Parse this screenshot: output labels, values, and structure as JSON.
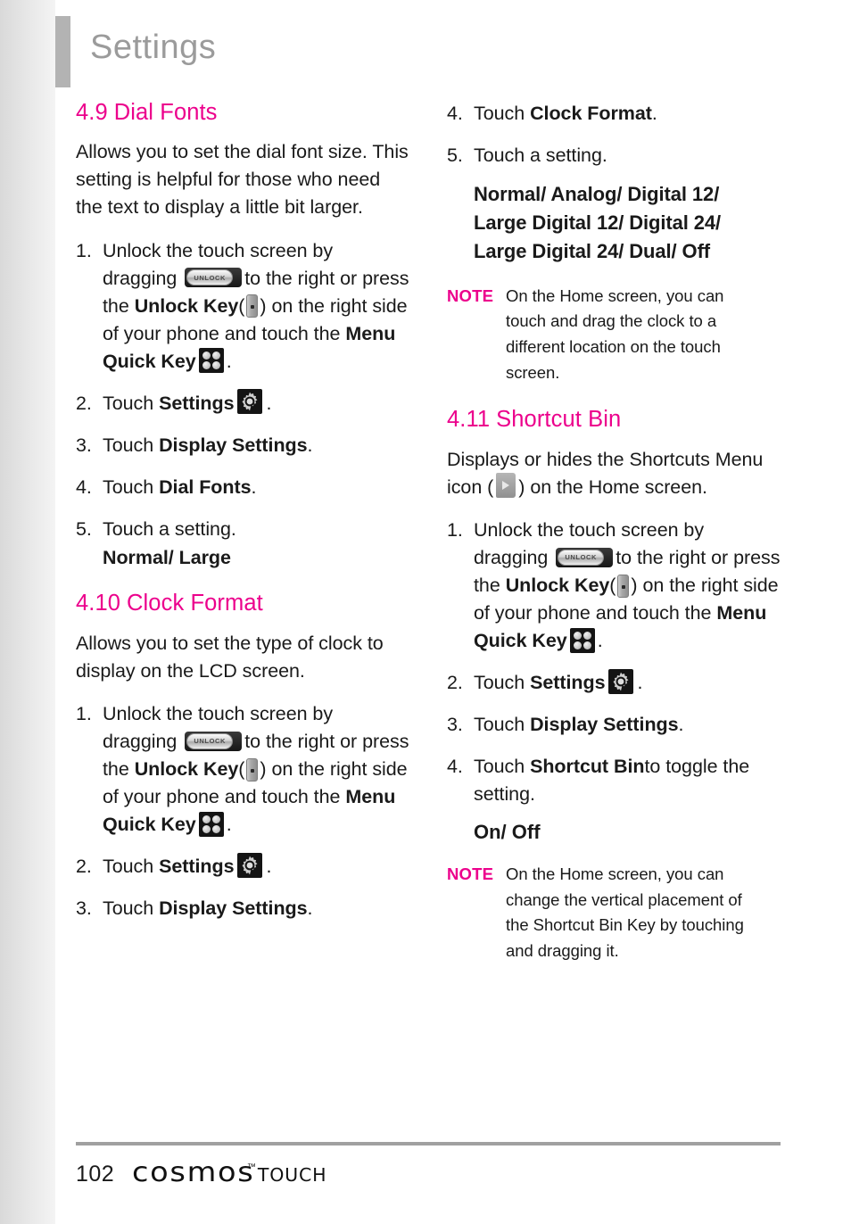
{
  "page": {
    "running_header": "Settings",
    "page_number": "102",
    "brand_name": "cosmos",
    "brand_tm": "™",
    "brand_suffix": "TOUCH",
    "accent_color": "#ec008c",
    "header_gray": "#9b9b9b"
  },
  "icons": {
    "unlock_label": "UNLOCK",
    "unlock_slider": "unlock-slider-icon",
    "unlock_key": "unlock-key-icon",
    "menu_quick_key": "menu-quick-key-icon",
    "settings_gear": "settings-gear-icon",
    "shortcuts_menu": "shortcuts-menu-icon"
  },
  "left_column": {
    "section_1": {
      "number": "4.9",
      "title": "Dial Fonts",
      "intro": "Allows you to set the dial font size. This setting is helpful for those who need the text to display a little bit larger.",
      "steps": [
        {
          "marker": "1.",
          "parts": {
            "t1": "Unlock the touch screen by dragging",
            "t2": "to the right or press the",
            "b1": "Unlock Key",
            "t3": "(",
            "t4": ") on the right side of your phone and touch the",
            "b2": "Menu Quick Key",
            "t5": "."
          }
        },
        {
          "marker": "2.",
          "parts": {
            "t1": "Touch",
            "b1": "Settings",
            "t2": "."
          }
        },
        {
          "marker": "3.",
          "parts": {
            "t1": "Touch",
            "b1": "Display Settings",
            "t2": "."
          }
        },
        {
          "marker": "4.",
          "parts": {
            "t1": "Touch",
            "b1": "Dial Fonts",
            "t2": "."
          }
        },
        {
          "marker": "5.",
          "parts": {
            "t1": "Touch a setting."
          },
          "options": "Normal/ Large"
        }
      ]
    },
    "section_2": {
      "number": "4.10",
      "title": "Clock Format",
      "intro": "Allows you to set the type of clock to display on the LCD screen.",
      "steps": [
        {
          "marker": "1.",
          "parts": {
            "t1": "Unlock the touch screen by dragging",
            "t2": "to the right or press the",
            "b1": "Unlock Key",
            "t3": "(",
            "t4": ") on the right side of your phone and touch the",
            "b2": "Menu Quick Key",
            "t5": "."
          }
        },
        {
          "marker": "2.",
          "parts": {
            "t1": "Touch",
            "b1": "Settings",
            "t2": "."
          }
        },
        {
          "marker": "3.",
          "parts": {
            "t1": "Touch",
            "b1": "Display Settings",
            "t2": "."
          }
        }
      ]
    }
  },
  "right_column": {
    "continued_steps": [
      {
        "marker": "4.",
        "parts": {
          "t1": "Touch",
          "b1": "Clock Format",
          "t2": "."
        }
      },
      {
        "marker": "5.",
        "parts": {
          "t1": "Touch a setting."
        }
      }
    ],
    "clock_options": [
      "Normal/ Analog/ Digital 12/",
      "Large Digital 12/ Digital 24/",
      "Large Digital 24/ Dual/ Off"
    ],
    "note_1": {
      "label": "NOTE",
      "lines": [
        "On the Home screen, you can",
        "touch and drag the clock to a",
        "different location on the touch",
        "screen."
      ]
    },
    "section_3": {
      "number": "4.11",
      "title": "Shortcut Bin",
      "intro_parts": {
        "t1": "Displays or hides the Shortcuts Menu icon (",
        "t2": ") on the Home screen."
      },
      "steps": [
        {
          "marker": "1.",
          "parts": {
            "t1": "Unlock the touch screen by dragging",
            "t2": "to the right or press the",
            "b1": "Unlock Key",
            "t3": "(",
            "t4": ") on the right side of your phone and touch the",
            "b2": "Menu Quick Key",
            "t5": "."
          }
        },
        {
          "marker": "2.",
          "parts": {
            "t1": "Touch",
            "b1": "Settings",
            "t2": "."
          }
        },
        {
          "marker": "3.",
          "parts": {
            "t1": "Touch",
            "b1": "Display Settings",
            "t2": "."
          }
        },
        {
          "marker": "4.",
          "parts": {
            "t1": "Touch",
            "b1": "Shortcut Bin",
            "t2": "to toggle the setting."
          },
          "options": "On/ Off"
        }
      ]
    },
    "note_2": {
      "label": "NOTE",
      "lines": [
        "On the Home screen, you can",
        "change the vertical placement of",
        "the Shortcut Bin Key by touching",
        "and dragging it."
      ]
    }
  }
}
